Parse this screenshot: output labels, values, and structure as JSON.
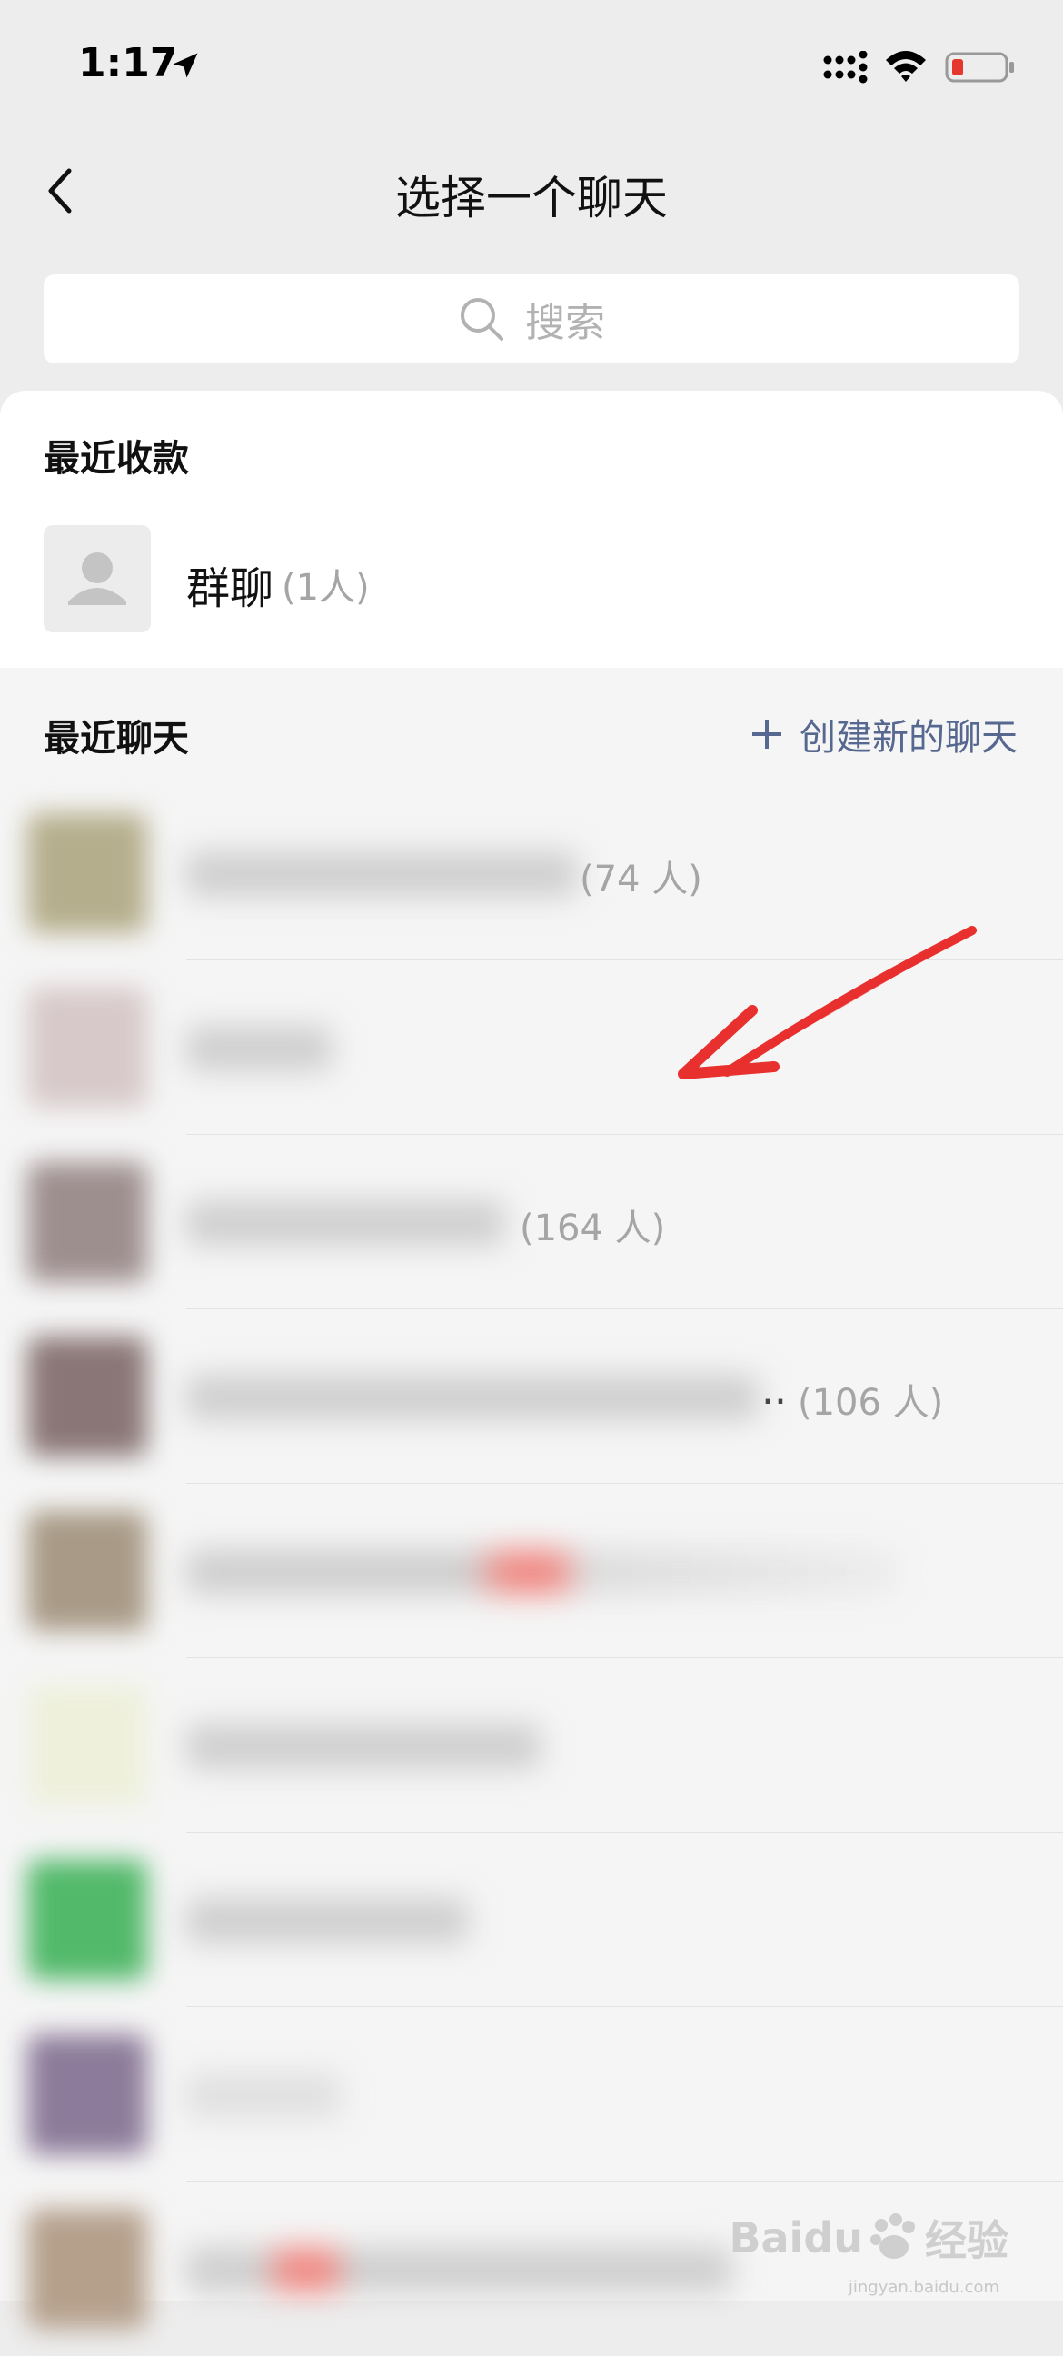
{
  "status_bar": {
    "time": "1:17"
  },
  "nav": {
    "title": "选择一个聊天"
  },
  "search": {
    "placeholder": "搜索"
  },
  "recent_payments": {
    "title": "最近收款",
    "items": [
      {
        "name": "群聊",
        "count": "(1人)"
      }
    ]
  },
  "recent_chats": {
    "title": "最近聊天",
    "create_label": "创建新的聊天",
    "items": [
      {
        "count": "(74 人)",
        "avatar_color": "#b5ae8c"
      },
      {
        "count": "",
        "avatar_color": "#d7c9c9"
      },
      {
        "count": "(164 人)",
        "avatar_color": "#9e8f8f"
      },
      {
        "count": "(106 人)",
        "truncated": "..",
        "avatar_color": "#8a7676"
      },
      {
        "count": "",
        "avatar_color": "#a89a86"
      },
      {
        "count": "",
        "avatar_color": "#eef0dc"
      },
      {
        "count": "",
        "avatar_color": "#52b96a"
      },
      {
        "count": "",
        "avatar_color": "#8c7b9a"
      },
      {
        "count": "",
        "avatar_color": "#b5a08c"
      }
    ]
  },
  "colors": {
    "background": "#ededed",
    "link": "#56688f",
    "annotation_arrow": "#e8302e",
    "battery_low": "#e5372d"
  },
  "watermark": {
    "left": "Baidu",
    "right": "经验",
    "sub": "jingyan.baidu.com"
  }
}
